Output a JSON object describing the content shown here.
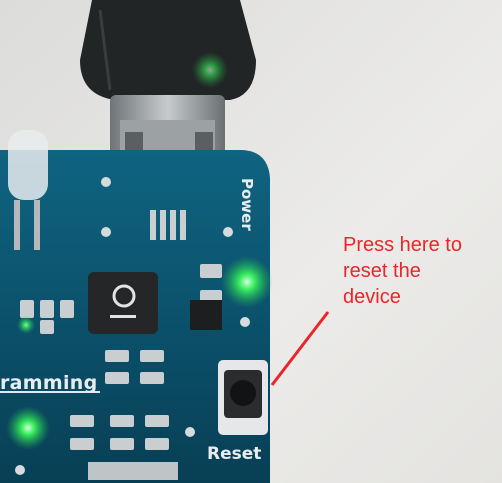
{
  "annotation": {
    "text": "Press here to\nreset the\ndevice",
    "color": "#e8262c"
  },
  "board": {
    "power_label": "Power",
    "reset_label": "Reset",
    "programming_label": "ramming",
    "pcb_color": "#0d5a74",
    "led_color": "#38ff5a"
  },
  "icons": [
    "usb-cable-icon",
    "usb-connector-icon",
    "led-icon",
    "reset-button-icon",
    "inductor-icon"
  ]
}
